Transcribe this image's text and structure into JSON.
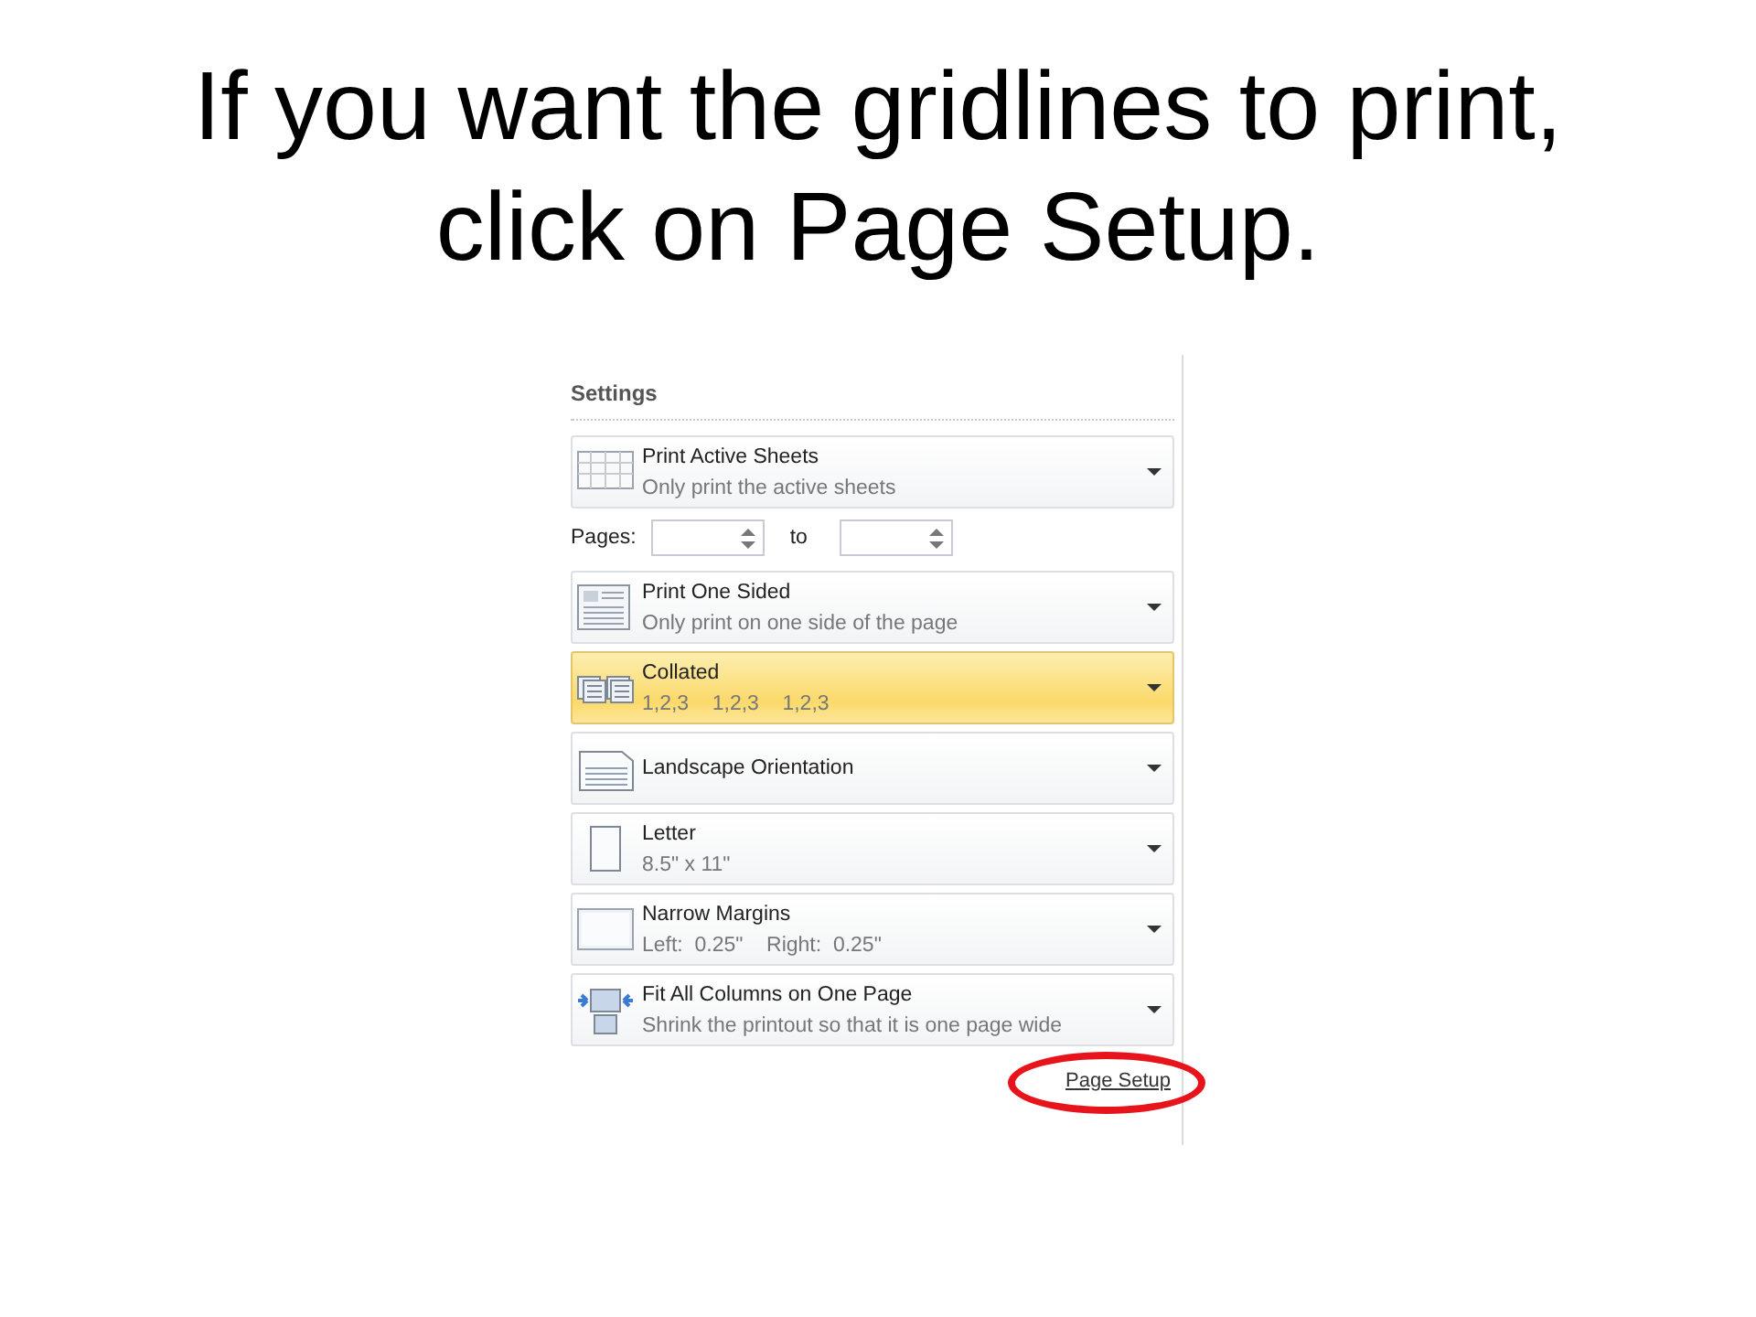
{
  "slide_title": "If you want the gridlines to print, click on Page Setup.",
  "settings": {
    "heading": "Settings",
    "print_what": {
      "kind": "sheets",
      "title": "Print Active Sheets",
      "subtitle": "Only print the active sheets",
      "highlighted": false
    },
    "pages": {
      "label": "Pages:",
      "to": "to"
    },
    "options": [
      {
        "kind": "sided",
        "title": "Print One Sided",
        "subtitle": "Only print on one side of the page",
        "highlighted": false
      },
      {
        "kind": "collated",
        "title": "Collated",
        "subtitle": "1,2,3    1,2,3    1,2,3",
        "highlighted": true
      },
      {
        "kind": "orientation",
        "title": "Landscape Orientation",
        "highlighted": false
      },
      {
        "kind": "paper",
        "title": "Letter",
        "subtitle": "8.5\" x 11\"",
        "highlighted": false
      },
      {
        "kind": "margins",
        "title": "Narrow Margins",
        "subtitle": "Left:  0.25\"    Right:  0.25\"",
        "highlighted": false
      },
      {
        "kind": "scaling",
        "title": "Fit All Columns on One Page",
        "subtitle": "Shrink the printout so that it is one page wide",
        "highlighted": false
      }
    ],
    "link": "Page Setup"
  }
}
